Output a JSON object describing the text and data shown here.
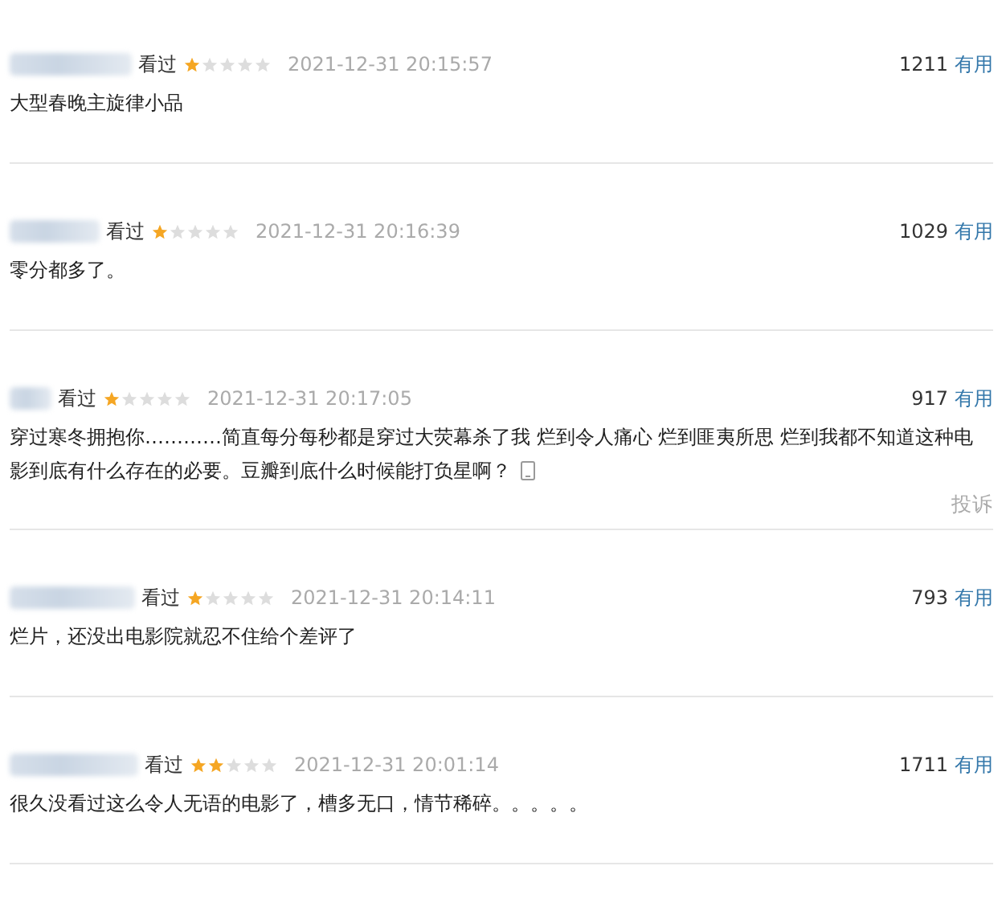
{
  "comments": [
    {
      "watched": "看过",
      "stars": 1,
      "time": "2021-12-31 20:15:57",
      "votes": "1211",
      "useful": "有用",
      "text": "大型春晚主旋律小品",
      "from_mobile": false
    },
    {
      "watched": "看过",
      "stars": 1,
      "time": "2021-12-31 20:16:39",
      "votes": "1029",
      "useful": "有用",
      "text": "零分都多了。",
      "from_mobile": false
    },
    {
      "watched": "看过",
      "stars": 1,
      "time": "2021-12-31 20:17:05",
      "votes": "917",
      "useful": "有用",
      "text": "穿过寒冬拥抱你…………简直每分每秒都是穿过大荧幕杀了我 烂到令人痛心 烂到匪夷所思 烂到我都不知道这种电影到底有什么存在的必要。豆瓣到底什么时候能打负星啊？",
      "from_mobile": true,
      "report": "投诉"
    },
    {
      "watched": "看过",
      "stars": 1,
      "time": "2021-12-31 20:14:11",
      "votes": "793",
      "useful": "有用",
      "text": "烂片，还没出电影院就忍不住给个差评了",
      "from_mobile": false
    },
    {
      "watched": "看过",
      "stars": 2,
      "time": "2021-12-31 20:01:14",
      "votes": "1711",
      "useful": "有用",
      "text": "很久没看过这么令人无语的电影了，槽多无口，情节稀碎。。。。。",
      "from_mobile": false
    }
  ]
}
